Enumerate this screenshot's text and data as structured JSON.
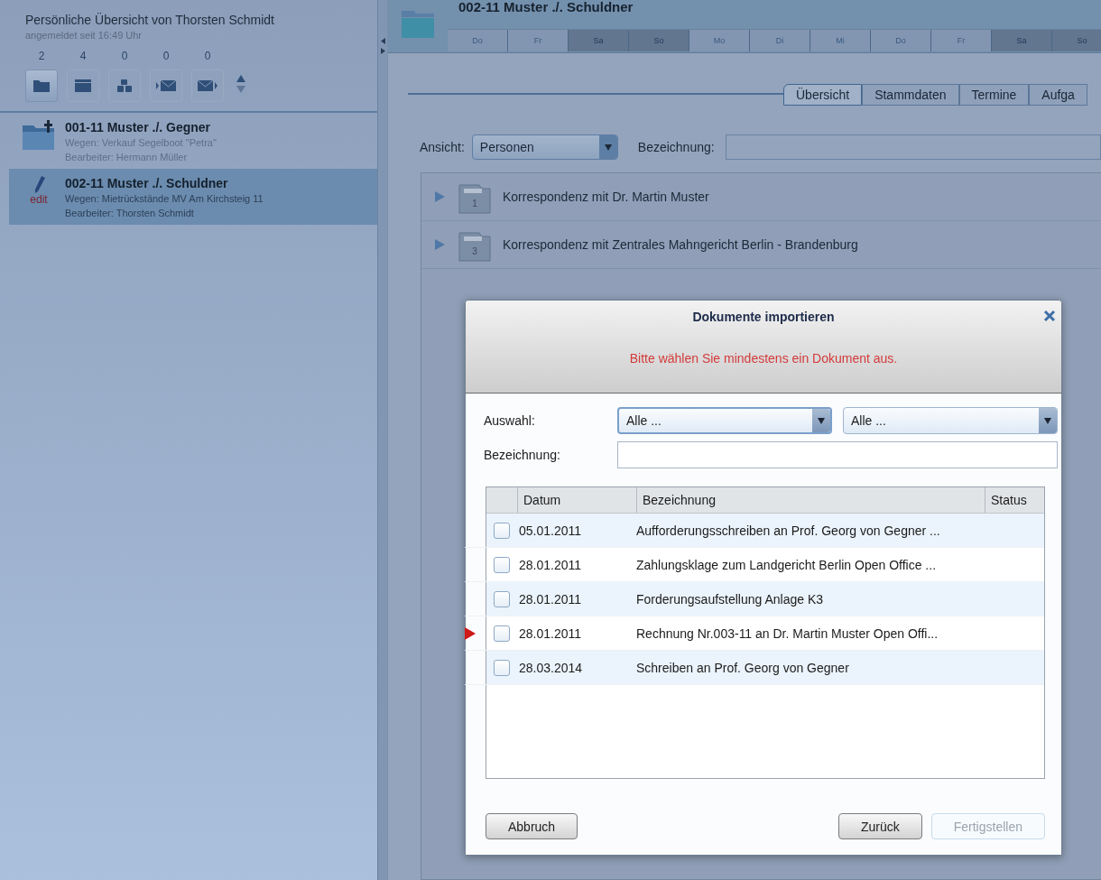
{
  "sidebar": {
    "title": "Persönliche Übersicht von Thorsten Schmidt",
    "subtitle": "angemeldet seit 16:49 Uhr",
    "toolbar": [
      {
        "count": "2",
        "kind": "folder",
        "selected": true
      },
      {
        "count": "4",
        "kind": "window",
        "selected": false
      },
      {
        "count": "0",
        "kind": "boxes",
        "selected": false
      },
      {
        "count": "0",
        "kind": "mail-in",
        "selected": false
      },
      {
        "count": "0",
        "kind": "mail-out",
        "selected": false
      }
    ],
    "cases": [
      {
        "kind": "folder",
        "title": "001-11 Muster ./. Gegner",
        "subject": "Wegen: Verkauf Segelboot \"Petra\"",
        "editor": "Bearbeiter: Hermann Müller",
        "selected": false
      },
      {
        "kind": "edit",
        "icon_text": "edit",
        "title": "002-11 Muster ./. Schuldner",
        "subject": "Wegen: Mietrückstände MV Am Kirchsteig 11",
        "editor": "Bearbeiter: Thorsten Schmidt",
        "selected": true
      }
    ]
  },
  "case_header": {
    "title": "002-11 Muster ./. Schuldner",
    "days": [
      {
        "label": "Do",
        "weekend": false
      },
      {
        "label": "Fr",
        "weekend": false
      },
      {
        "label": "Sa",
        "weekend": true
      },
      {
        "label": "So",
        "weekend": true
      },
      {
        "label": "Mo",
        "weekend": false
      },
      {
        "label": "Di",
        "weekend": false
      },
      {
        "label": "Mi",
        "weekend": false
      },
      {
        "label": "Do",
        "weekend": false
      },
      {
        "label": "Fr",
        "weekend": false
      },
      {
        "label": "Sa",
        "weekend": true
      },
      {
        "label": "So",
        "weekend": true
      }
    ]
  },
  "tabs": [
    {
      "label": "Übersicht",
      "selected": true
    },
    {
      "label": "Stammdaten",
      "selected": false
    },
    {
      "label": "Termine",
      "selected": false
    },
    {
      "label": "Aufga",
      "selected": false
    }
  ],
  "filter": {
    "view_label": "Ansicht:",
    "view_value": "Personen",
    "name_label": "Bezeichnung:"
  },
  "tree": [
    {
      "number": "1",
      "label": "Korrespondenz mit Dr. Martin Muster"
    },
    {
      "number": "3",
      "label": "Korrespondenz mit Zentrales Mahngericht Berlin - Brandenburg"
    }
  ],
  "dialog": {
    "title": "Dokumente importieren",
    "message": "Bitte wählen Sie mindestens ein Dokument aus.",
    "selection_label": "Auswahl:",
    "select_1": "Alle ...",
    "select_2": "Alle ...",
    "name_label": "Bezeichnung:",
    "columns": [
      "Datum",
      "Bezeichnung",
      "Status"
    ],
    "rows": [
      {
        "date": "05.01.2011",
        "name": "Aufforderungsschreiben an Prof. Georg von Gegner ...",
        "checked": false,
        "pointer": false
      },
      {
        "date": "28.01.2011",
        "name": "Zahlungsklage zum Landgericht Berlin Open Office ...",
        "checked": false,
        "pointer": false
      },
      {
        "date": "28.01.2011",
        "name": "Forderungsaufstellung Anlage K3",
        "checked": false,
        "pointer": false
      },
      {
        "date": "28.01.2011",
        "name": "Rechnung Nr.003-11 an Dr. Martin Muster Open Offi...",
        "checked": false,
        "pointer": true
      },
      {
        "date": "28.03.2014",
        "name": "Schreiben an Prof. Georg von Gegner",
        "checked": false,
        "pointer": false
      }
    ],
    "buttons": [
      {
        "label": "Abbruch",
        "disabled": false
      },
      {
        "label": "Zurück",
        "disabled": false
      },
      {
        "label": "Fertigstellen",
        "disabled": true
      }
    ]
  }
}
